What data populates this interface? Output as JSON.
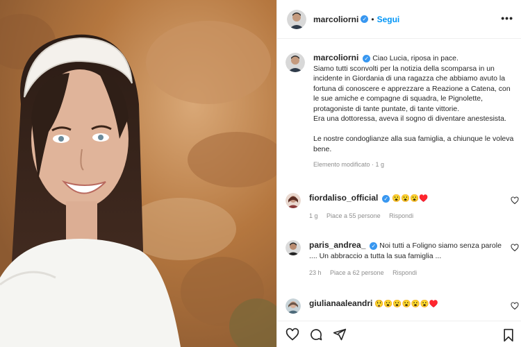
{
  "post": {
    "username": "marcoliorni",
    "follow_label": "Segui",
    "caption": "Ciao Lucia, riposa in pace.\nSiamo tutti sconvolti per la notizia della scomparsa in un incidente in Giordania di una ragazza che abbiamo avuto la fortuna di conoscere e apprezzare a Reazione a Catena, con le sue amiche e compagne di squadra, le Pignolette, protagoniste di tante puntate, di tante vittorie.\nEra una dottoressa, aveva il sogno di diventare anestesista.\n\nLe nostre condoglianze alla sua famiglia, a chiunque le voleva bene.",
    "meta": "Elemento modificato · 1 g"
  },
  "comments": [
    {
      "username": "fiordaliso_official",
      "text": "😮😮😮♥️",
      "time": "1 g",
      "likes": "Piace a 55 persone",
      "reply": "Rispondi"
    },
    {
      "username": "paris_andrea_",
      "text": "Noi tutti a Foligno siamo senza parole .... Un abbraccio a tutta la sua famiglia ...",
      "time": "23 h",
      "likes": "Piace a 62 persone",
      "reply": "Rispondi"
    },
    {
      "username": "giulianaaleandri",
      "text": "😲😮😮😮😮😮♥️"
    }
  ],
  "icons": {
    "more": "more-options-icon",
    "verified": "verified-badge-icon",
    "like": "heart-icon",
    "comment": "comment-icon",
    "share": "share-icon",
    "save": "bookmark-icon"
  },
  "colors": {
    "accent": "#0095f6",
    "verified": "#3897f0",
    "muted": "#8e8e8e",
    "border": "#efefef"
  }
}
